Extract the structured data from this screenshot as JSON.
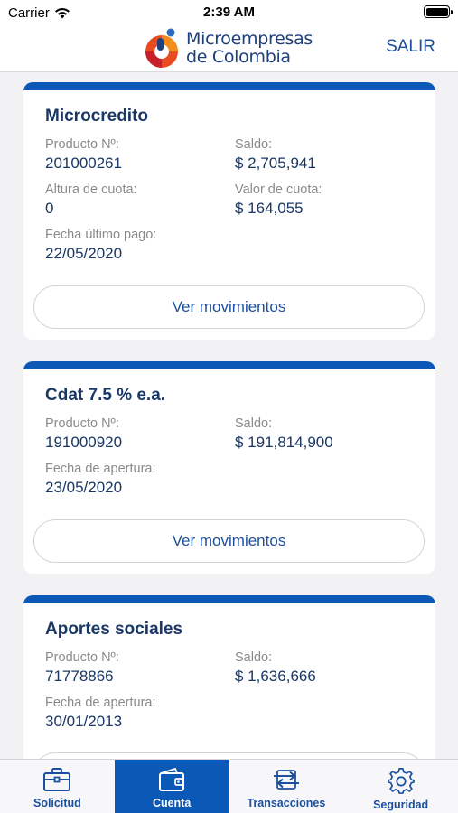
{
  "status_bar": {
    "carrier": "Carrier",
    "time": "2:39 AM"
  },
  "header": {
    "logo_line1": "Microempresas",
    "logo_line2": "de Colombia",
    "logout_label": "SALIR"
  },
  "cards": [
    {
      "title": "Microcredito",
      "product_label": "Producto Nº:",
      "product_value": "201000261",
      "balance_label": "Saldo:",
      "balance_value": "$ 2,705,941",
      "quota_height_label": "Altura de cuota:",
      "quota_height_value": "0",
      "quota_value_label": "Valor de cuota:",
      "quota_value_value": "$ 164,055",
      "date_label": "Fecha último pago:",
      "date_value": "22/05/2020",
      "button_label": "Ver movimientos"
    },
    {
      "title": "Cdat  7.5 % e.a.",
      "product_label": "Producto Nº:",
      "product_value": "191000920",
      "balance_label": "Saldo:",
      "balance_value": "$ 191,814,900",
      "date_label": "Fecha de apertura:",
      "date_value": "23/05/2020",
      "button_label": "Ver movimientos"
    },
    {
      "title": "Aportes sociales",
      "product_label": "Producto Nº:",
      "product_value": "71778866",
      "balance_label": "Saldo:",
      "balance_value": "$ 1,636,666",
      "date_label": "Fecha de apertura:",
      "date_value": "30/01/2013"
    }
  ],
  "tabs": [
    {
      "label": "Solicitud",
      "icon": "briefcase-icon",
      "active": false
    },
    {
      "label": "Cuenta",
      "icon": "wallet-icon",
      "active": true
    },
    {
      "label": "Transacciones",
      "icon": "transfer-icon",
      "active": false
    },
    {
      "label": "Seguridad",
      "icon": "gear-icon",
      "active": false
    }
  ],
  "colors": {
    "primary": "#0c58b6",
    "text_dark": "#1a3866",
    "label_gray": "#8a8a8a"
  }
}
